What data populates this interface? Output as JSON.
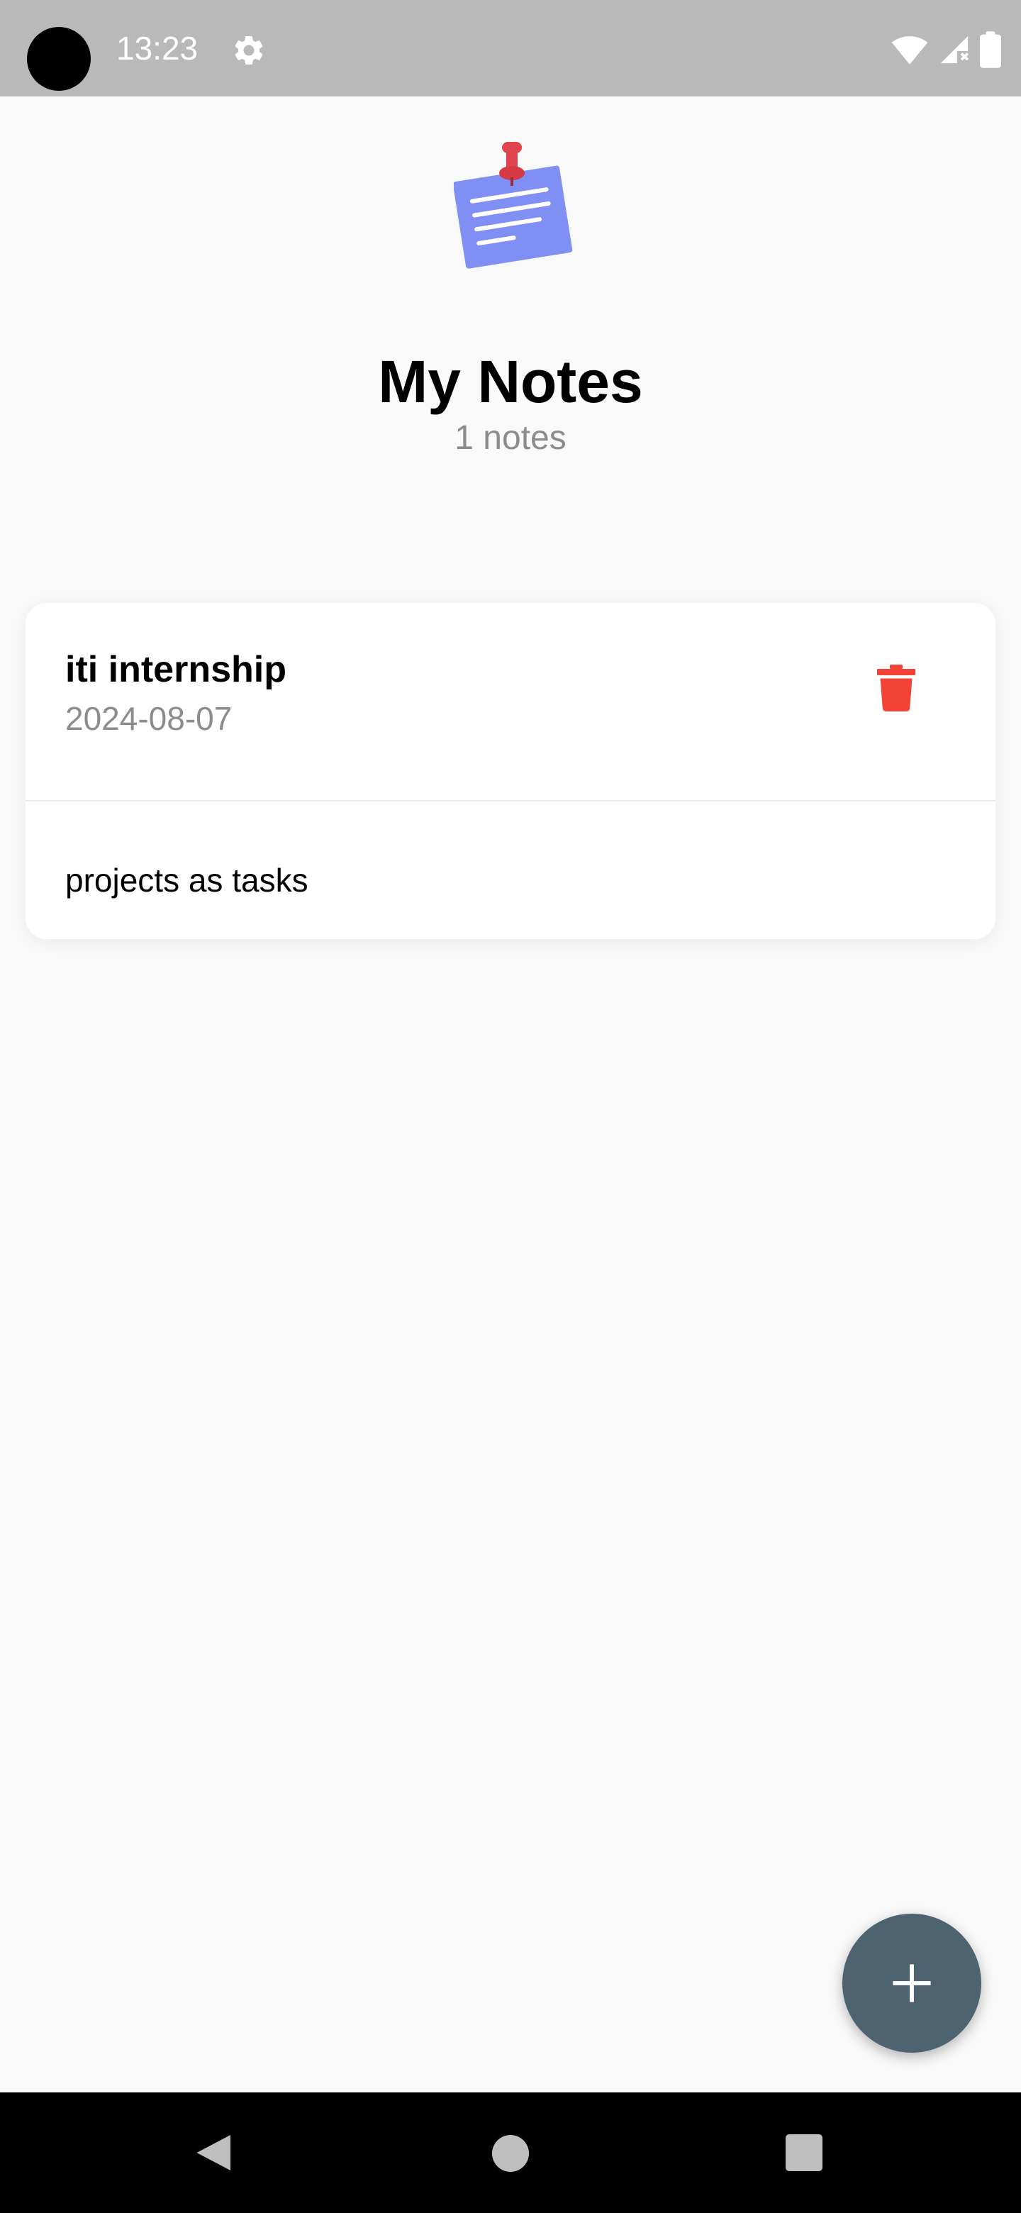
{
  "status_bar": {
    "time": "13:23",
    "icons": [
      "settings-icon",
      "wifi-icon",
      "cell-signal-icon",
      "battery-icon"
    ]
  },
  "header": {
    "logo_icon": "pinned-note-icon",
    "title": "My Notes",
    "count_label": "1 notes"
  },
  "notes": [
    {
      "title": "iti internship",
      "date": "2024-08-07",
      "body": "projects as tasks",
      "delete_icon": "trash-icon"
    }
  ],
  "fab": {
    "icon": "plus-icon"
  },
  "nav_bar": {
    "buttons": [
      "back-icon",
      "home-icon",
      "recents-icon"
    ]
  },
  "colors": {
    "background": "#f9f9f9",
    "status_bar": "#b9b9b9",
    "delete": "#f44336",
    "fab": "#4e6370",
    "muted_text": "#8c8c8c",
    "logo_note": "#7f8ff4",
    "logo_pin": "#e0444e"
  }
}
